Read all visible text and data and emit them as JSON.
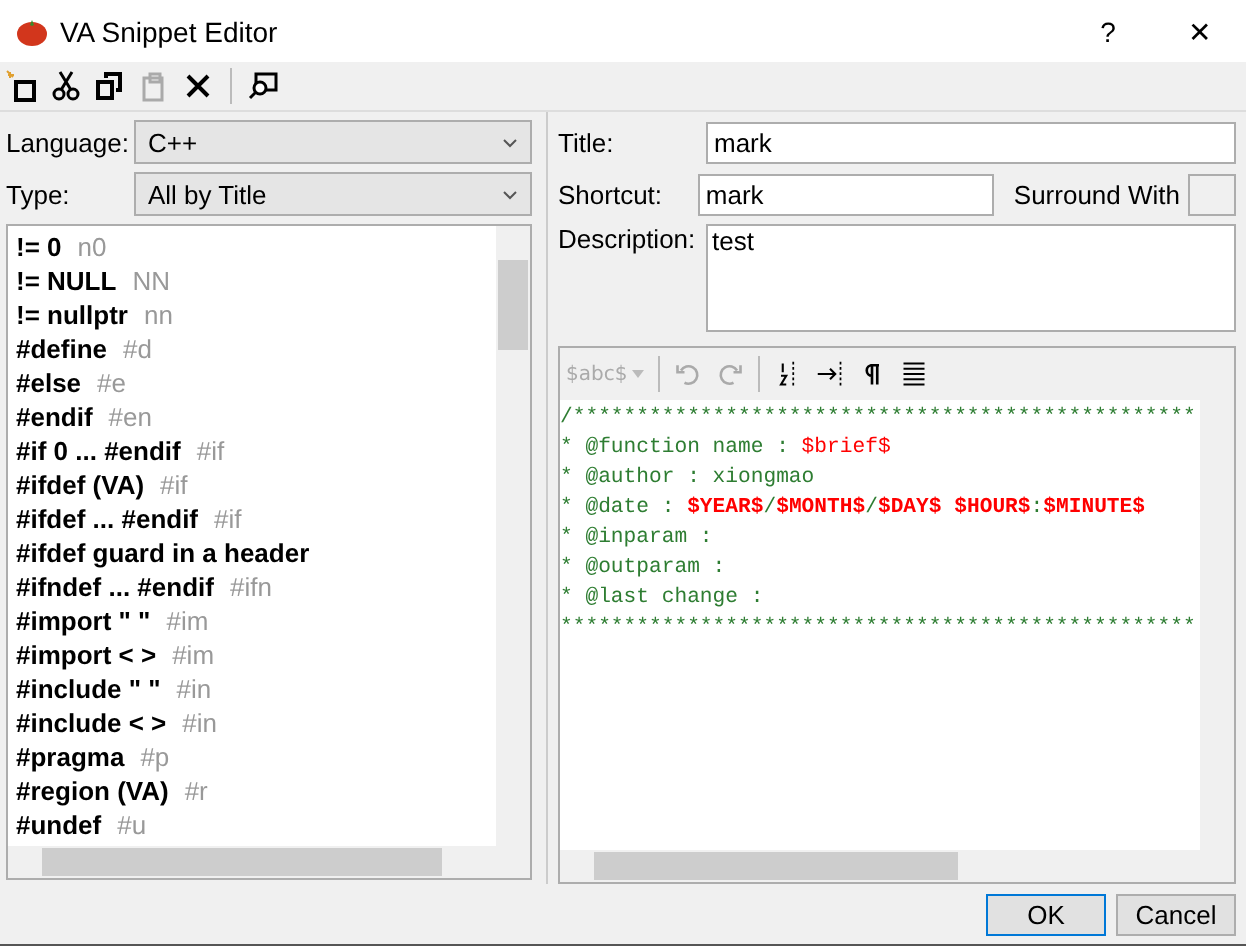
{
  "window": {
    "title": "VA Snippet Editor",
    "help": "?",
    "close": "✕"
  },
  "left": {
    "language": {
      "label": "Language:",
      "value": "C++"
    },
    "type": {
      "label": "Type:",
      "value": "All by Title"
    },
    "snippets": [
      {
        "title": "!= 0",
        "shortcut": "n0",
        "selected": false
      },
      {
        "title": "!= NULL",
        "shortcut": "NN",
        "selected": false
      },
      {
        "title": "!= nullptr",
        "shortcut": "nn",
        "selected": false
      },
      {
        "title": "#define",
        "shortcut": "#d",
        "selected": false
      },
      {
        "title": "#else",
        "shortcut": "#e",
        "selected": false
      },
      {
        "title": "#endif",
        "shortcut": "#en",
        "selected": false
      },
      {
        "title": "#if 0 ... #endif",
        "shortcut": "#if",
        "selected": false
      },
      {
        "title": "#ifdef (VA)",
        "shortcut": "#if",
        "selected": false
      },
      {
        "title": "#ifdef ... #endif",
        "shortcut": "#if",
        "selected": false
      },
      {
        "title": "#ifdef guard in a header",
        "selected": false
      },
      {
        "title": "#ifndef ... #endif",
        "shortcut": "#ifn",
        "selected": false
      },
      {
        "title": "#import \" \"",
        "shortcut": "#im",
        "selected": false
      },
      {
        "title": "#import < >",
        "shortcut": "#im",
        "selected": false
      },
      {
        "title": "#include \" \"",
        "shortcut": "#in",
        "selected": false
      },
      {
        "title": "#include < >",
        "shortcut": "#in",
        "selected": false
      },
      {
        "title": "#pragma",
        "shortcut": "#p",
        "selected": false
      },
      {
        "title": "#region (VA)",
        "shortcut": "#r",
        "selected": false
      },
      {
        "title": "#undef",
        "shortcut": "#u",
        "selected": false
      }
    ]
  },
  "right": {
    "title": {
      "label": "Title:",
      "value": "mark"
    },
    "shortcut": {
      "label": "Shortcut:",
      "value": "mark"
    },
    "surround": {
      "label": "Surround With"
    },
    "description": {
      "label": "Description:",
      "value": "test"
    },
    "editor_toolbar": {
      "reserved": "$abc$"
    },
    "code": [
      [
        {
          "kind": "plain",
          "text": "/*************************************************"
        }
      ],
      [
        {
          "kind": "plain",
          "text": "* @function name : "
        },
        {
          "kind": "var",
          "text": "$brief$"
        }
      ],
      [
        {
          "kind": "plain",
          "text": "* @author : xiongmao"
        }
      ],
      [
        {
          "kind": "plain",
          "text": "* @date : "
        },
        {
          "kind": "var-bold",
          "text": "$YEAR$"
        },
        {
          "kind": "plain",
          "text": "/"
        },
        {
          "kind": "var-bold",
          "text": "$MONTH$"
        },
        {
          "kind": "plain",
          "text": "/"
        },
        {
          "kind": "var-bold",
          "text": "$DAY$"
        },
        {
          "kind": "var-bold",
          "text": " $HOUR$"
        },
        {
          "kind": "plain",
          "text": ":"
        },
        {
          "kind": "var-bold",
          "text": "$MINUTE$"
        }
      ],
      [
        {
          "kind": "plain",
          "text": "* @inparam :"
        }
      ],
      [
        {
          "kind": "plain",
          "text": "* @outparam :"
        }
      ],
      [
        {
          "kind": "plain",
          "text": "* @last change :"
        }
      ],
      [
        {
          "kind": "plain",
          "text": "**************************************************"
        }
      ]
    ]
  },
  "buttons": [
    {
      "label": "OK",
      "default": true
    },
    {
      "label": "Cancel",
      "default": false
    }
  ]
}
